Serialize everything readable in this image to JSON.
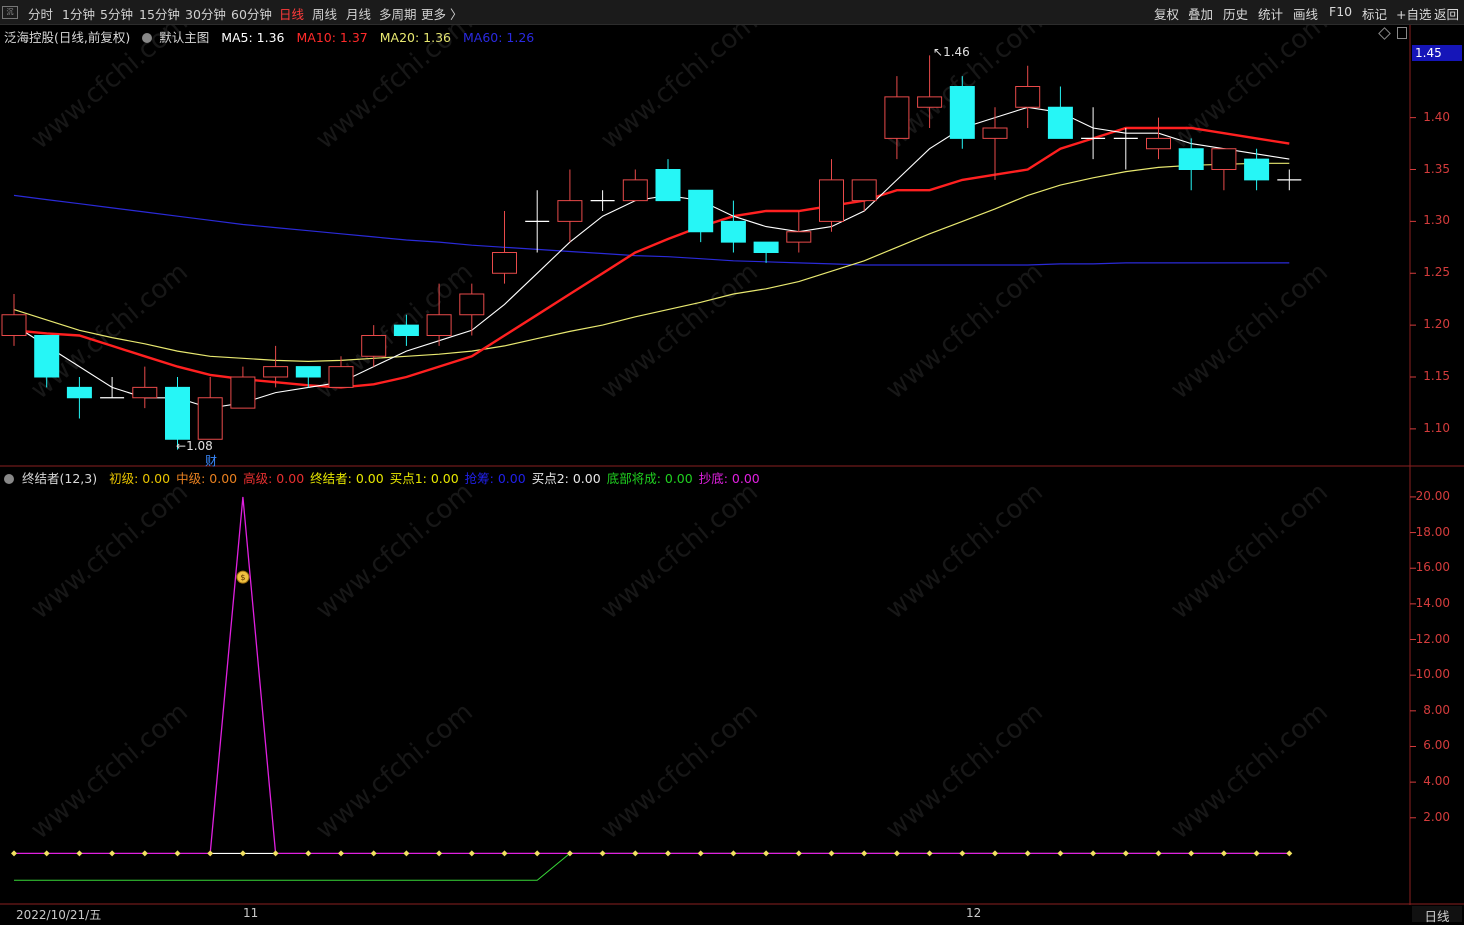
{
  "toolbar": {
    "left_items": [
      "分时",
      "1分钟",
      "5分钟",
      "15分钟",
      "30分钟",
      "60分钟",
      "日线",
      "周线",
      "月线",
      "多周期",
      "更多 〉"
    ],
    "active": "日线",
    "right_items": [
      "复权",
      "叠加",
      "历史",
      "统计",
      "画线",
      "F10",
      "标记",
      "+自选",
      "返回"
    ]
  },
  "main_legend": {
    "stock": "泛海控股(日线,前复权)",
    "template": "默认主图",
    "ma5": "MA5: 1.36",
    "ma10": "MA10: 1.37",
    "ma20": "MA20: 1.36",
    "ma60": "MA60: 1.26"
  },
  "colors": {
    "up": "#e84a4a",
    "down": "#26f6f6",
    "ma5": "#ffffff",
    "ma10": "#ff2020",
    "ma20": "#e8e870",
    "ma60": "#2a2ad8",
    "purple": "#e020e0",
    "green": "#38d838",
    "axis": "#d43c3c"
  },
  "price_axis": {
    "ticks": [
      "1.40",
      "1.35",
      "1.30",
      "1.25",
      "1.20",
      "1.15",
      "1.10"
    ],
    "current": "1.45"
  },
  "annotations": {
    "high": "1.46",
    "low": "1.08",
    "finance_marker": "财"
  },
  "indicator_legend": {
    "name": "终结者(12,3)",
    "items": [
      {
        "label": "初级: 0.00",
        "color": "#e8c400"
      },
      {
        "label": "中级: 0.00",
        "color": "#e88020"
      },
      {
        "label": "高级: 0.00",
        "color": "#e83030"
      },
      {
        "label": "终结者: 0.00",
        "color": "#e8e800"
      },
      {
        "label": "买点1: 0.00",
        "color": "#e8e800"
      },
      {
        "label": "抢筹: 0.00",
        "color": "#2020e8"
      },
      {
        "label": "买点2: 0.00",
        "color": "#e8e8e8"
      },
      {
        "label": "底部将成: 0.00",
        "color": "#20d020"
      },
      {
        "label": "抄底: 0.00",
        "color": "#e020e0"
      }
    ]
  },
  "indicator_axis": {
    "ticks": [
      "20.00",
      "18.00",
      "16.00",
      "14.00",
      "12.00",
      "10.00",
      "8.00",
      "6.00",
      "4.00",
      "2.00"
    ]
  },
  "date_axis": {
    "first": "2022/10/21/五",
    "marks": [
      "11",
      "12"
    ],
    "period": "日线"
  },
  "watermark": "www.cfchi.com",
  "chart_data": {
    "type": "candlestick",
    "candles": [
      {
        "o": 1.19,
        "h": 1.23,
        "l": 1.18,
        "c": 1.21
      },
      {
        "o": 1.19,
        "h": 1.19,
        "l": 1.14,
        "c": 1.15
      },
      {
        "o": 1.14,
        "h": 1.15,
        "l": 1.11,
        "c": 1.13
      },
      {
        "o": 1.13,
        "h": 1.15,
        "l": 1.13,
        "c": 1.13
      },
      {
        "o": 1.13,
        "h": 1.16,
        "l": 1.12,
        "c": 1.14
      },
      {
        "o": 1.14,
        "h": 1.15,
        "l": 1.08,
        "c": 1.09
      },
      {
        "o": 1.09,
        "h": 1.15,
        "l": 1.09,
        "c": 1.13
      },
      {
        "o": 1.12,
        "h": 1.16,
        "l": 1.12,
        "c": 1.15
      },
      {
        "o": 1.15,
        "h": 1.18,
        "l": 1.14,
        "c": 1.16
      },
      {
        "o": 1.16,
        "h": 1.16,
        "l": 1.14,
        "c": 1.15
      },
      {
        "o": 1.14,
        "h": 1.17,
        "l": 1.14,
        "c": 1.16
      },
      {
        "o": 1.17,
        "h": 1.2,
        "l": 1.16,
        "c": 1.19
      },
      {
        "o": 1.2,
        "h": 1.21,
        "l": 1.18,
        "c": 1.19
      },
      {
        "o": 1.19,
        "h": 1.24,
        "l": 1.18,
        "c": 1.21
      },
      {
        "o": 1.21,
        "h": 1.24,
        "l": 1.19,
        "c": 1.23
      },
      {
        "o": 1.25,
        "h": 1.31,
        "l": 1.24,
        "c": 1.27
      },
      {
        "o": 1.3,
        "h": 1.33,
        "l": 1.27,
        "c": 1.3
      },
      {
        "o": 1.3,
        "h": 1.35,
        "l": 1.28,
        "c": 1.32
      },
      {
        "o": 1.32,
        "h": 1.33,
        "l": 1.31,
        "c": 1.32
      },
      {
        "o": 1.32,
        "h": 1.35,
        "l": 1.32,
        "c": 1.34
      },
      {
        "o": 1.35,
        "h": 1.36,
        "l": 1.32,
        "c": 1.32
      },
      {
        "o": 1.33,
        "h": 1.33,
        "l": 1.28,
        "c": 1.29
      },
      {
        "o": 1.3,
        "h": 1.32,
        "l": 1.27,
        "c": 1.28
      },
      {
        "o": 1.28,
        "h": 1.28,
        "l": 1.26,
        "c": 1.27
      },
      {
        "o": 1.28,
        "h": 1.31,
        "l": 1.27,
        "c": 1.29
      },
      {
        "o": 1.3,
        "h": 1.36,
        "l": 1.29,
        "c": 1.34
      },
      {
        "o": 1.32,
        "h": 1.34,
        "l": 1.31,
        "c": 1.34
      },
      {
        "o": 1.38,
        "h": 1.44,
        "l": 1.36,
        "c": 1.42
      },
      {
        "o": 1.41,
        "h": 1.46,
        "l": 1.39,
        "c": 1.42
      },
      {
        "o": 1.43,
        "h": 1.44,
        "l": 1.37,
        "c": 1.38
      },
      {
        "o": 1.38,
        "h": 1.41,
        "l": 1.34,
        "c": 1.39
      },
      {
        "o": 1.41,
        "h": 1.45,
        "l": 1.39,
        "c": 1.43
      },
      {
        "o": 1.41,
        "h": 1.43,
        "l": 1.38,
        "c": 1.38
      },
      {
        "o": 1.38,
        "h": 1.41,
        "l": 1.36,
        "c": 1.38
      },
      {
        "o": 1.38,
        "h": 1.39,
        "l": 1.35,
        "c": 1.38
      },
      {
        "o": 1.37,
        "h": 1.4,
        "l": 1.36,
        "c": 1.38
      },
      {
        "o": 1.37,
        "h": 1.38,
        "l": 1.33,
        "c": 1.35
      },
      {
        "o": 1.35,
        "h": 1.37,
        "l": 1.33,
        "c": 1.37
      },
      {
        "o": 1.36,
        "h": 1.37,
        "l": 1.33,
        "c": 1.34
      },
      {
        "o": 1.34,
        "h": 1.35,
        "l": 1.33,
        "c": 1.34
      }
    ],
    "ma5": [
      1.2,
      1.18,
      1.16,
      1.14,
      1.13,
      1.13,
      1.12,
      1.125,
      1.135,
      1.14,
      1.145,
      1.16,
      1.175,
      1.185,
      1.195,
      1.22,
      1.25,
      1.28,
      1.305,
      1.32,
      1.325,
      1.32,
      1.305,
      1.295,
      1.29,
      1.295,
      1.31,
      1.34,
      1.37,
      1.39,
      1.4,
      1.41,
      1.405,
      1.39,
      1.385,
      1.385,
      1.375,
      1.37,
      1.365,
      1.36
    ],
    "ma10": [
      1.195,
      1.192,
      1.19,
      1.18,
      1.17,
      1.16,
      1.152,
      1.148,
      1.145,
      1.142,
      1.14,
      1.143,
      1.15,
      1.16,
      1.17,
      1.19,
      1.21,
      1.23,
      1.25,
      1.27,
      1.283,
      1.295,
      1.305,
      1.31,
      1.31,
      1.315,
      1.32,
      1.33,
      1.33,
      1.34,
      1.345,
      1.35,
      1.37,
      1.38,
      1.39,
      1.39,
      1.39,
      1.385,
      1.38,
      1.375
    ],
    "ma20": [
      1.215,
      1.205,
      1.195,
      1.188,
      1.182,
      1.175,
      1.17,
      1.168,
      1.166,
      1.165,
      1.166,
      1.168,
      1.17,
      1.172,
      1.175,
      1.18,
      1.187,
      1.194,
      1.2,
      1.208,
      1.215,
      1.222,
      1.23,
      1.235,
      1.242,
      1.252,
      1.262,
      1.275,
      1.288,
      1.3,
      1.312,
      1.325,
      1.335,
      1.342,
      1.348,
      1.352,
      1.354,
      1.355,
      1.356,
      1.356
    ],
    "ma60": [
      1.325,
      1.321,
      1.317,
      1.313,
      1.309,
      1.305,
      1.301,
      1.297,
      1.294,
      1.291,
      1.288,
      1.285,
      1.282,
      1.28,
      1.277,
      1.275,
      1.273,
      1.271,
      1.269,
      1.267,
      1.266,
      1.264,
      1.262,
      1.261,
      1.26,
      1.259,
      1.258,
      1.258,
      1.258,
      1.258,
      1.258,
      1.258,
      1.259,
      1.259,
      1.26,
      1.26,
      1.26,
      1.26,
      1.26,
      1.26
    ],
    "price_range": [
      1.07,
      1.47
    ],
    "indicator": {
      "purple": [
        0,
        0,
        0,
        0,
        0,
        0,
        0,
        20,
        0,
        0,
        0,
        0,
        0,
        0,
        0,
        0,
        0,
        0,
        0,
        0,
        0,
        0,
        0,
        0,
        0,
        0,
        0,
        0,
        0,
        0,
        0,
        0,
        0,
        0,
        0,
        0,
        0,
        0,
        0,
        0
      ],
      "green": [
        -1.5,
        -1.5,
        -1.5,
        -1.5,
        -1.5,
        -1.5,
        -1.5,
        -1.5,
        -1.5,
        -1.5,
        -1.5,
        -1.5,
        -1.5,
        -1.5,
        -1.5,
        -1.5,
        -1.5,
        0,
        0,
        0,
        0,
        0,
        0,
        0,
        0,
        0,
        0,
        0,
        0,
        0,
        0,
        0,
        0,
        0,
        0,
        0,
        0,
        0,
        0,
        0
      ],
      "range": [
        -2.5,
        20.5
      ]
    }
  }
}
